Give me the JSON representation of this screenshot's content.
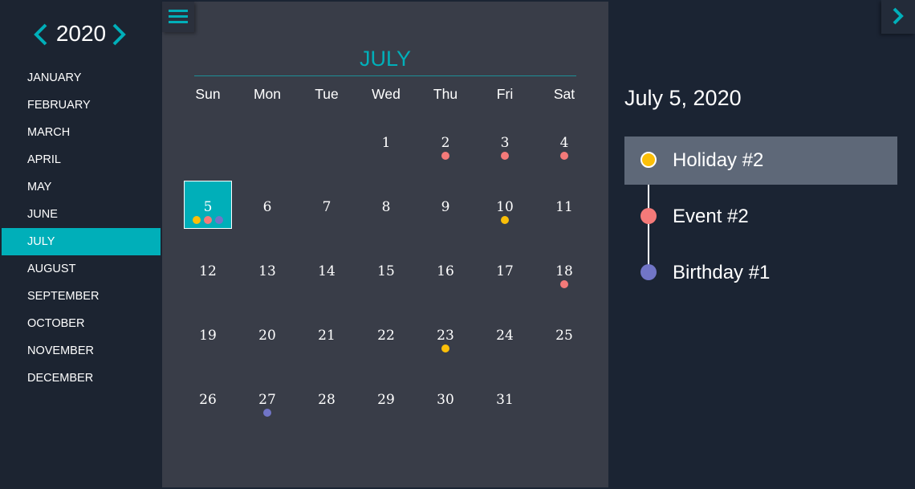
{
  "colors": {
    "accent": "#00afb9",
    "holiday": "#fbbf08",
    "event": "#f47a79",
    "birthday": "#7175c7"
  },
  "sidebar": {
    "year": "2020",
    "prev_icon": "chevron-left-icon",
    "next_icon": "chevron-right-icon",
    "months": [
      "JANUARY",
      "FEBRUARY",
      "MARCH",
      "APRIL",
      "MAY",
      "JUNE",
      "JULY",
      "AUGUST",
      "SEPTEMBER",
      "OCTOBER",
      "NOVEMBER",
      "DECEMBER"
    ],
    "active_month": "JULY"
  },
  "calendar": {
    "menu_icon": "hamburger-menu-icon",
    "month_title": "JULY",
    "weekdays": [
      "Sun",
      "Mon",
      "Tue",
      "Wed",
      "Thu",
      "Fri",
      "Sat"
    ],
    "first_weekday_index": 3,
    "days_in_month": 31,
    "selected_day": 5,
    "day_dots": {
      "2": [
        "event"
      ],
      "3": [
        "event"
      ],
      "4": [
        "event"
      ],
      "5": [
        "holiday",
        "event",
        "birthday"
      ],
      "10": [
        "holiday"
      ],
      "18": [
        "event"
      ],
      "23": [
        "holiday"
      ],
      "27": [
        "birthday"
      ]
    }
  },
  "detail": {
    "expand_icon": "chevron-right-icon",
    "date_heading": "July 5, 2020",
    "events": [
      {
        "label": "Holiday #2",
        "type": "holiday",
        "active": true
      },
      {
        "label": "Event #2",
        "type": "event",
        "active": false
      },
      {
        "label": "Birthday #1",
        "type": "birthday",
        "active": false
      }
    ]
  }
}
